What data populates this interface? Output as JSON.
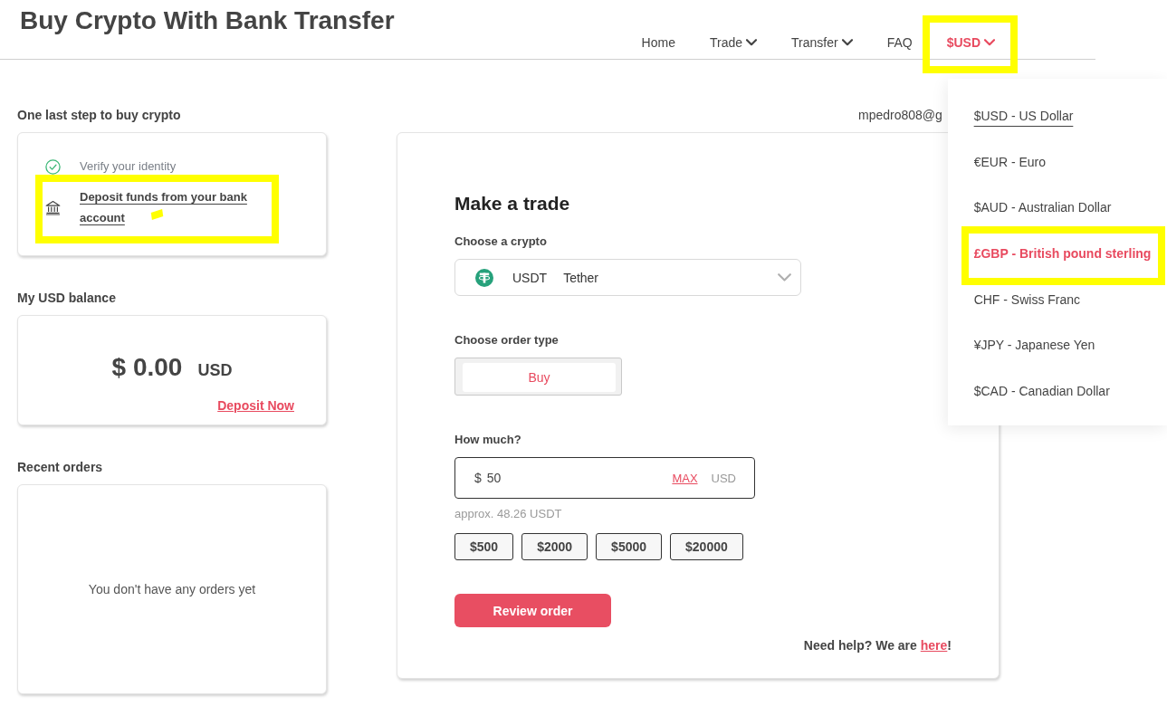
{
  "page": {
    "title": "Buy Crypto With Bank Transfer"
  },
  "nav": [
    {
      "label": "Home",
      "dropdown": false,
      "active": false,
      "expanded": false,
      "highlighted": false
    },
    {
      "label": "Trade",
      "dropdown": true,
      "active": false,
      "expanded": false,
      "highlighted": false
    },
    {
      "label": "Transfer",
      "dropdown": true,
      "active": false,
      "expanded": false,
      "highlighted": false
    },
    {
      "label": "FAQ",
      "dropdown": false,
      "active": false,
      "expanded": false,
      "highlighted": false
    },
    {
      "label": "$USD",
      "dropdown": true,
      "active": true,
      "expanded": true,
      "highlighted": true
    }
  ],
  "currency_menu": [
    {
      "label": "$USD - US Dollar",
      "selected": true,
      "hovered": false,
      "highlighted": false
    },
    {
      "label": "€EUR - Euro",
      "selected": false,
      "hovered": false,
      "highlighted": false
    },
    {
      "label": "$AUD - Australian Dollar",
      "selected": false,
      "hovered": false,
      "highlighted": false
    },
    {
      "label": "£GBP - British pound sterling",
      "selected": false,
      "hovered": true,
      "highlighted": true
    },
    {
      "label": "CHF - Swiss Franc",
      "selected": false,
      "hovered": false,
      "highlighted": false
    },
    {
      "label": "¥JPY - Japanese Yen",
      "selected": false,
      "hovered": false,
      "highlighted": false
    },
    {
      "label": "$CAD - Canadian Dollar",
      "selected": false,
      "hovered": false,
      "highlighted": false
    }
  ],
  "account_email": "mpedro808@g",
  "onboarding": {
    "heading": "One last step to buy crypto",
    "steps": [
      {
        "label": "Verify your identity",
        "done": true,
        "highlighted": false
      },
      {
        "label": "Deposit funds from your bank account",
        "done": false,
        "highlighted": true
      }
    ]
  },
  "balance": {
    "heading": "My USD balance",
    "amount": "$ 0.00",
    "currency": "USD",
    "action": "Deposit Now"
  },
  "recent_orders": {
    "heading": "Recent orders",
    "empty_message": "You don't have any orders yet"
  },
  "trade": {
    "title": "Make a trade",
    "crypto_label": "Choose a crypto",
    "crypto": {
      "symbol": "USDT",
      "name": "Tether"
    },
    "order_type_label": "Choose order type",
    "order_types": [
      {
        "label": "Buy",
        "selected": true
      }
    ],
    "amount_label": "How much?",
    "amount": {
      "prefix": "$",
      "value": "50",
      "max": "MAX",
      "currency": "USD"
    },
    "estimate": "approx. 48.26 USDT",
    "presets": [
      "$500",
      "$2000",
      "$5000",
      "$20000"
    ],
    "submit": "Review order",
    "help": {
      "text": "Need help? We are",
      "link": "here",
      "suffix": "!"
    }
  }
}
